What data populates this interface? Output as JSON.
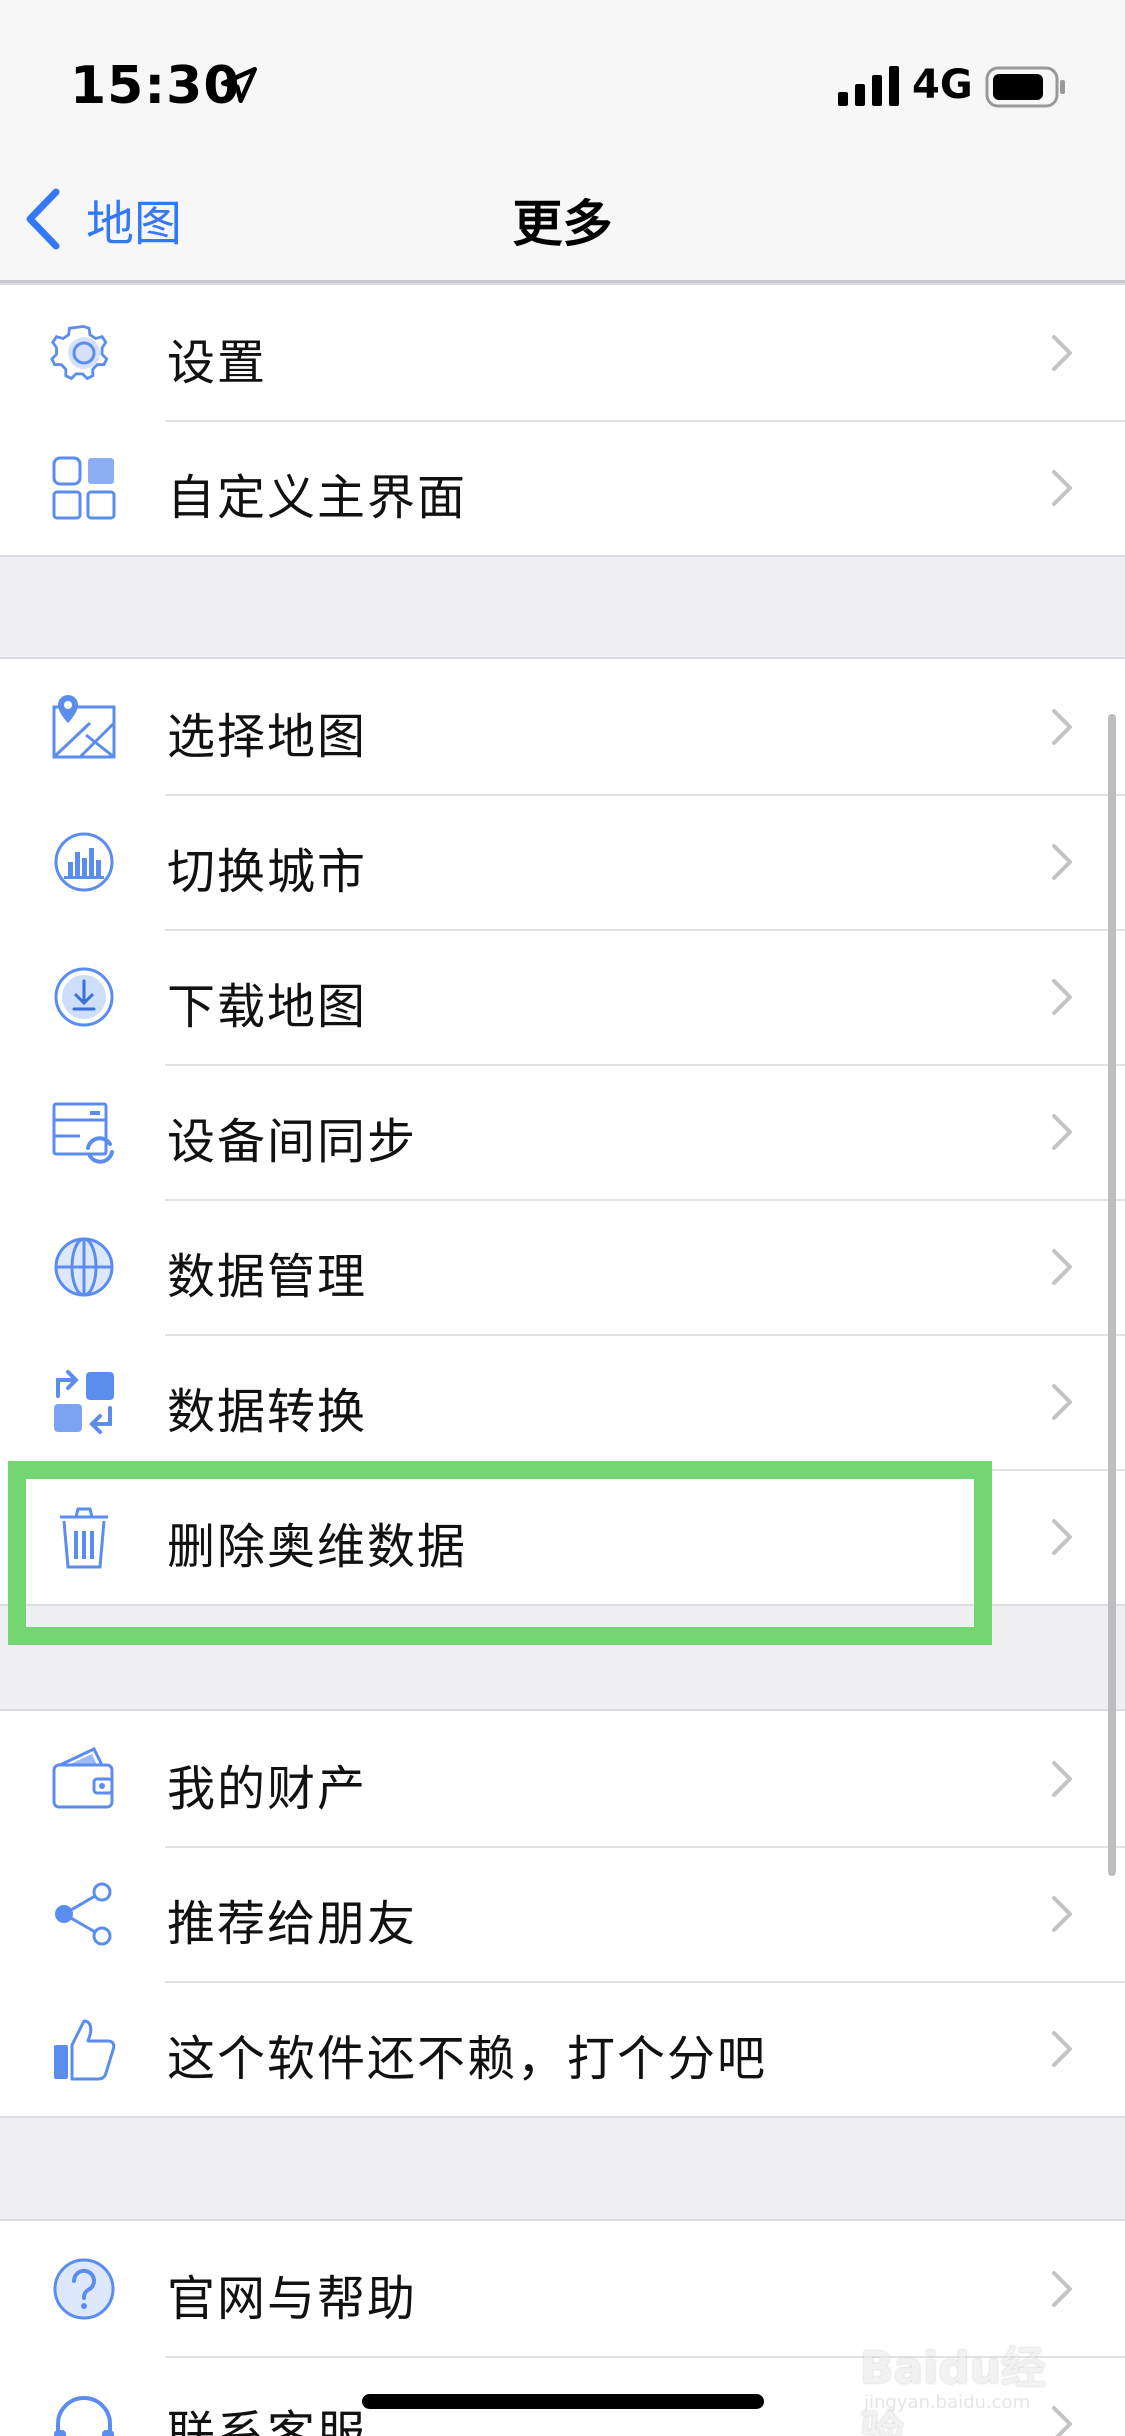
{
  "status_bar": {
    "time": "15:30",
    "network": "4G"
  },
  "nav": {
    "back_label": "地图",
    "title": "更多"
  },
  "groups": [
    {
      "items": [
        {
          "label": "设置",
          "icon": "gear-icon"
        },
        {
          "label": "自定义主界面",
          "icon": "grid-layout-icon"
        }
      ]
    },
    {
      "items": [
        {
          "label": "选择地图",
          "icon": "map-pin-icon"
        },
        {
          "label": "切换城市",
          "icon": "city-icon"
        },
        {
          "label": "下载地图",
          "icon": "download-icon"
        },
        {
          "label": "设备间同步",
          "icon": "sync-icon"
        },
        {
          "label": "数据管理",
          "icon": "globe-icon"
        },
        {
          "label": "数据转换",
          "icon": "convert-icon"
        },
        {
          "label": "删除奥维数据",
          "icon": "trash-icon"
        }
      ]
    },
    {
      "items": [
        {
          "label": "我的财产",
          "icon": "wallet-icon"
        },
        {
          "label": "推荐给朋友",
          "icon": "share-icon"
        },
        {
          "label": "这个软件还不赖，打个分吧",
          "icon": "thumbs-up-icon"
        }
      ]
    },
    {
      "items": [
        {
          "label": "官网与帮助",
          "icon": "help-icon"
        },
        {
          "label": "联系客服",
          "icon": "headset-icon"
        }
      ]
    }
  ],
  "watermark": {
    "logo": "Baidu经验",
    "url": "jingyan.baidu.com"
  },
  "colors": {
    "accent": "#3478f6",
    "icon": "#5b8def",
    "highlight": "#73d673"
  }
}
